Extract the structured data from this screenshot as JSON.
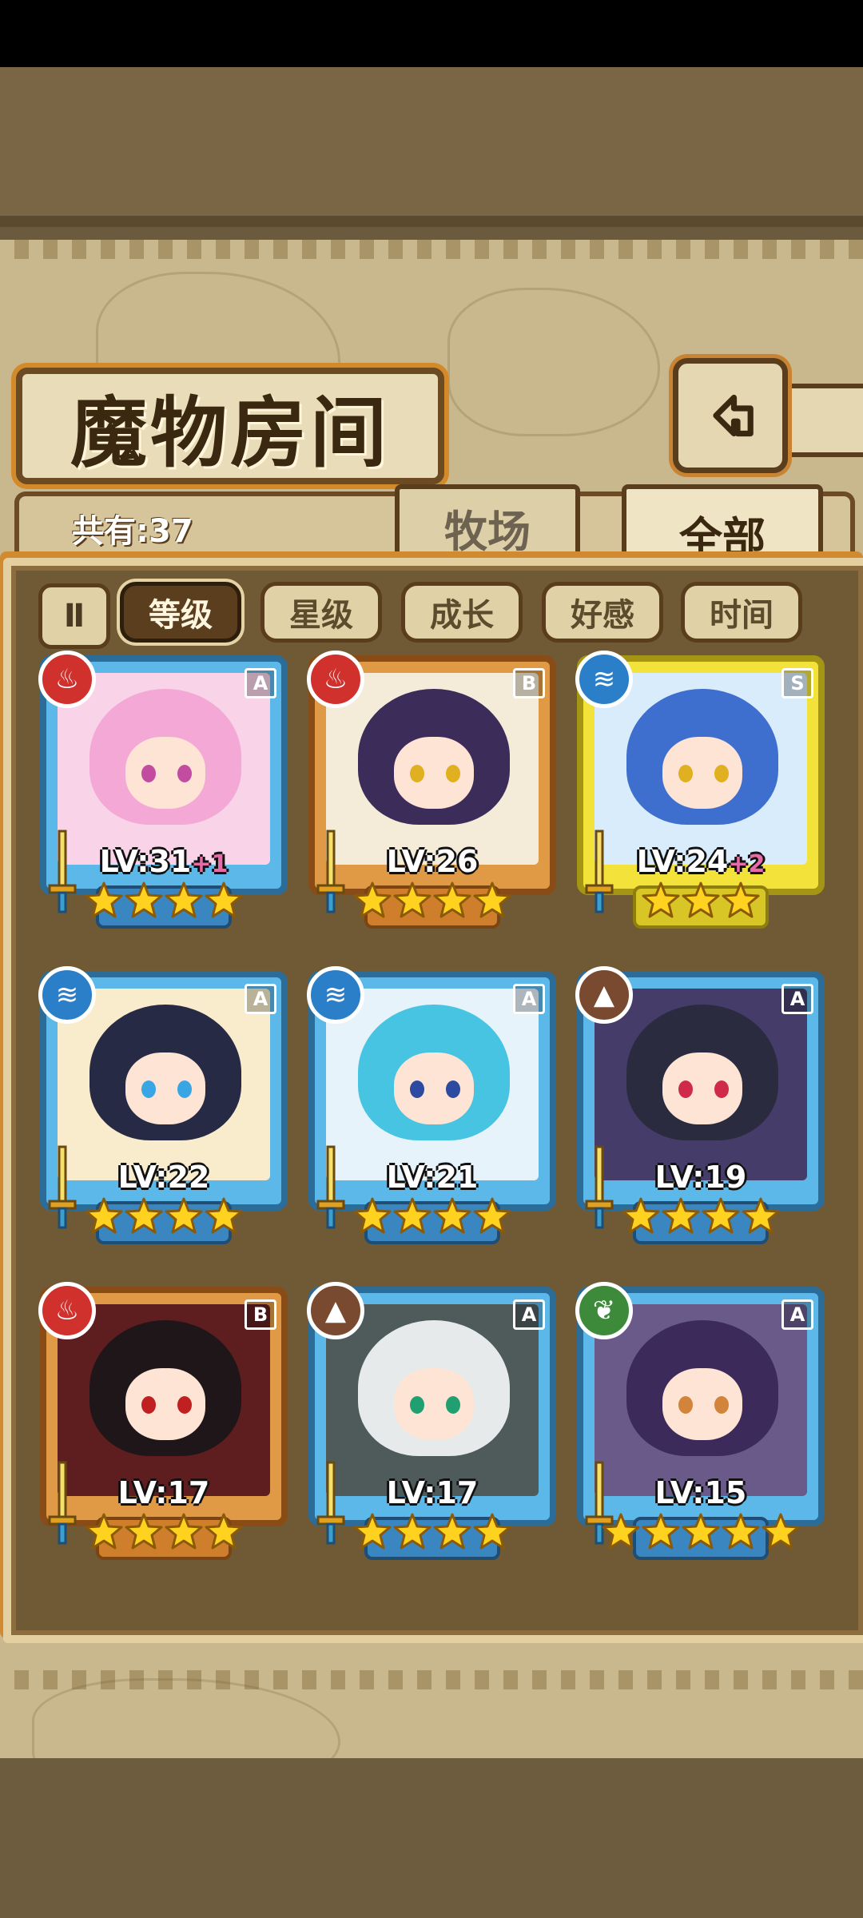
{
  "header": {
    "title": "魔物房间",
    "count_label": "共有:37"
  },
  "tabs": [
    {
      "label": "牧场",
      "active": false
    },
    {
      "label": "全部",
      "active": true
    }
  ],
  "filters": {
    "toggle_label": "Ⅱ",
    "options": [
      {
        "label": "等级",
        "selected": true
      },
      {
        "label": "星级",
        "selected": false
      },
      {
        "label": "成长",
        "selected": false
      },
      {
        "label": "好感",
        "selected": false
      },
      {
        "label": "时间",
        "selected": false
      }
    ]
  },
  "monsters": [
    {
      "level": "LV:31",
      "bonus": "+1",
      "rank": "A",
      "element": "fire-icon",
      "stars": 4,
      "frame": "blue",
      "colors": {
        "hair": "#f3a8d6",
        "bg": "#f9d3e8",
        "eye": "#c24ca0"
      }
    },
    {
      "level": "LV:26",
      "bonus": "",
      "rank": "B",
      "element": "fire-icon",
      "stars": 4,
      "frame": "orange",
      "colors": {
        "hair": "#3b2c5a",
        "bg": "#f4ecd8",
        "eye": "#e0b020"
      }
    },
    {
      "level": "LV:24",
      "bonus": "+2",
      "rank": "S",
      "element": "water-icon",
      "stars": 3,
      "frame": "gold",
      "colors": {
        "hair": "#3e6fcf",
        "bg": "#d9ecfb",
        "eye": "#e0b020"
      }
    },
    {
      "level": "LV:22",
      "bonus": "",
      "rank": "A",
      "element": "water-icon",
      "stars": 4,
      "frame": "blue",
      "colors": {
        "hair": "#262a44",
        "bg": "#f8eccd",
        "eye": "#3aa5e5"
      }
    },
    {
      "level": "LV:21",
      "bonus": "",
      "rank": "A",
      "element": "water-icon",
      "stars": 4,
      "frame": "blue",
      "colors": {
        "hair": "#47c4e2",
        "bg": "#e7f3fb",
        "eye": "#2b4aa0"
      }
    },
    {
      "level": "LV:19",
      "bonus": "",
      "rank": "A",
      "element": "earth-icon",
      "stars": 4,
      "frame": "blue",
      "colors": {
        "hair": "#2b2b40",
        "bg": "#453c6a",
        "eye": "#d02a4a"
      }
    },
    {
      "level": "LV:17",
      "bonus": "",
      "rank": "B",
      "element": "fire-icon",
      "stars": 4,
      "frame": "orange",
      "colors": {
        "hair": "#1e1618",
        "bg": "#5e1e20",
        "eye": "#c02020"
      }
    },
    {
      "level": "LV:17",
      "bonus": "",
      "rank": "A",
      "element": "earth-icon",
      "stars": 4,
      "frame": "blue",
      "colors": {
        "hair": "#e6eaea",
        "bg": "#4f5b5b",
        "eye": "#20a070"
      }
    },
    {
      "level": "LV:15",
      "bonus": "",
      "rank": "A",
      "element": "wind-icon",
      "stars": 5,
      "frame": "blue",
      "colors": {
        "hair": "#3c2a5a",
        "bg": "#6a5a8a",
        "eye": "#d2843a"
      }
    }
  ],
  "element_colors": {
    "fire-icon": "#d0312d",
    "water-icon": "#2a7fc8",
    "earth-icon": "#7a4a30",
    "wind-icon": "#3d8a3a"
  }
}
